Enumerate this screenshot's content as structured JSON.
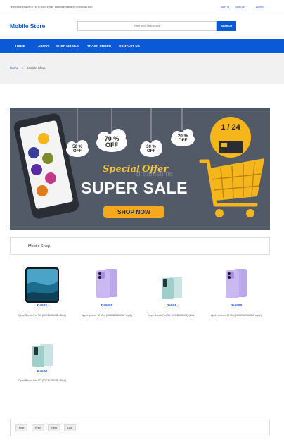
{
  "topbar": {
    "contact": "Telephone Enquiry: 7787979460 Email: pradhibeingsharee72@gmail.com",
    "sign_in": "Sign In",
    "sign_up": "Sign Up",
    "admin": "Admin"
  },
  "header": {
    "logo": "Mobile Store",
    "search_placeholder": "Enter your search key",
    "search_button": "SEARCH"
  },
  "nav": {
    "items": [
      "HOME",
      "ABOUT",
      "SHOP MOBILE",
      "TRACK ORDER",
      "CONTACT US"
    ]
  },
  "breadcrumb": {
    "home": "Home",
    "separator": ">",
    "current": "Mobile Shop"
  },
  "banner": {
    "tags": [
      "50 % OFF",
      "70 % OFF",
      "30 % OFF",
      "20 % OFF"
    ],
    "badge": "1 / 24",
    "special": "Special",
    "offer": "Offer",
    "headline": "SUPER SALE",
    "cta": "SHOP NOW",
    "watermark": "dreamstime"
  },
  "section": {
    "title": "Mobile Shop."
  },
  "products": [
    {
      "price": "Rs500",
      "name": "Oppo Renoo Pro 5G (12GB/256GB) (Blue)",
      "image": "oppo-blue"
    },
    {
      "price": "Rs1500",
      "name": "Apple Iphone 12 Mini (128GB/256GB/Purple)",
      "image": "iphone-purple"
    },
    {
      "price": "Rs500",
      "name": "Oppo Renoo Pro 5G (12GB/256GB) (Blue)",
      "image": "oppo-teal"
    },
    {
      "price": "Rs1500",
      "name": "Apple Iphone 12 Mini (128GB/256GB/Purple)",
      "image": "iphone-purple"
    },
    {
      "price": "Rs500",
      "name": "Oppo Renoo Pro 5G (12GB/256GB) (Blue)",
      "image": "oppo-teal"
    }
  ],
  "pagination": {
    "first": "First",
    "prev": "Prev",
    "next": "Next",
    "last": "Last"
  },
  "colors": {
    "brand": "#0a5ad8",
    "banner_bg": "#525a67",
    "cart_yellow": "#f4b61a",
    "headline_yellow": "#f7c531"
  }
}
